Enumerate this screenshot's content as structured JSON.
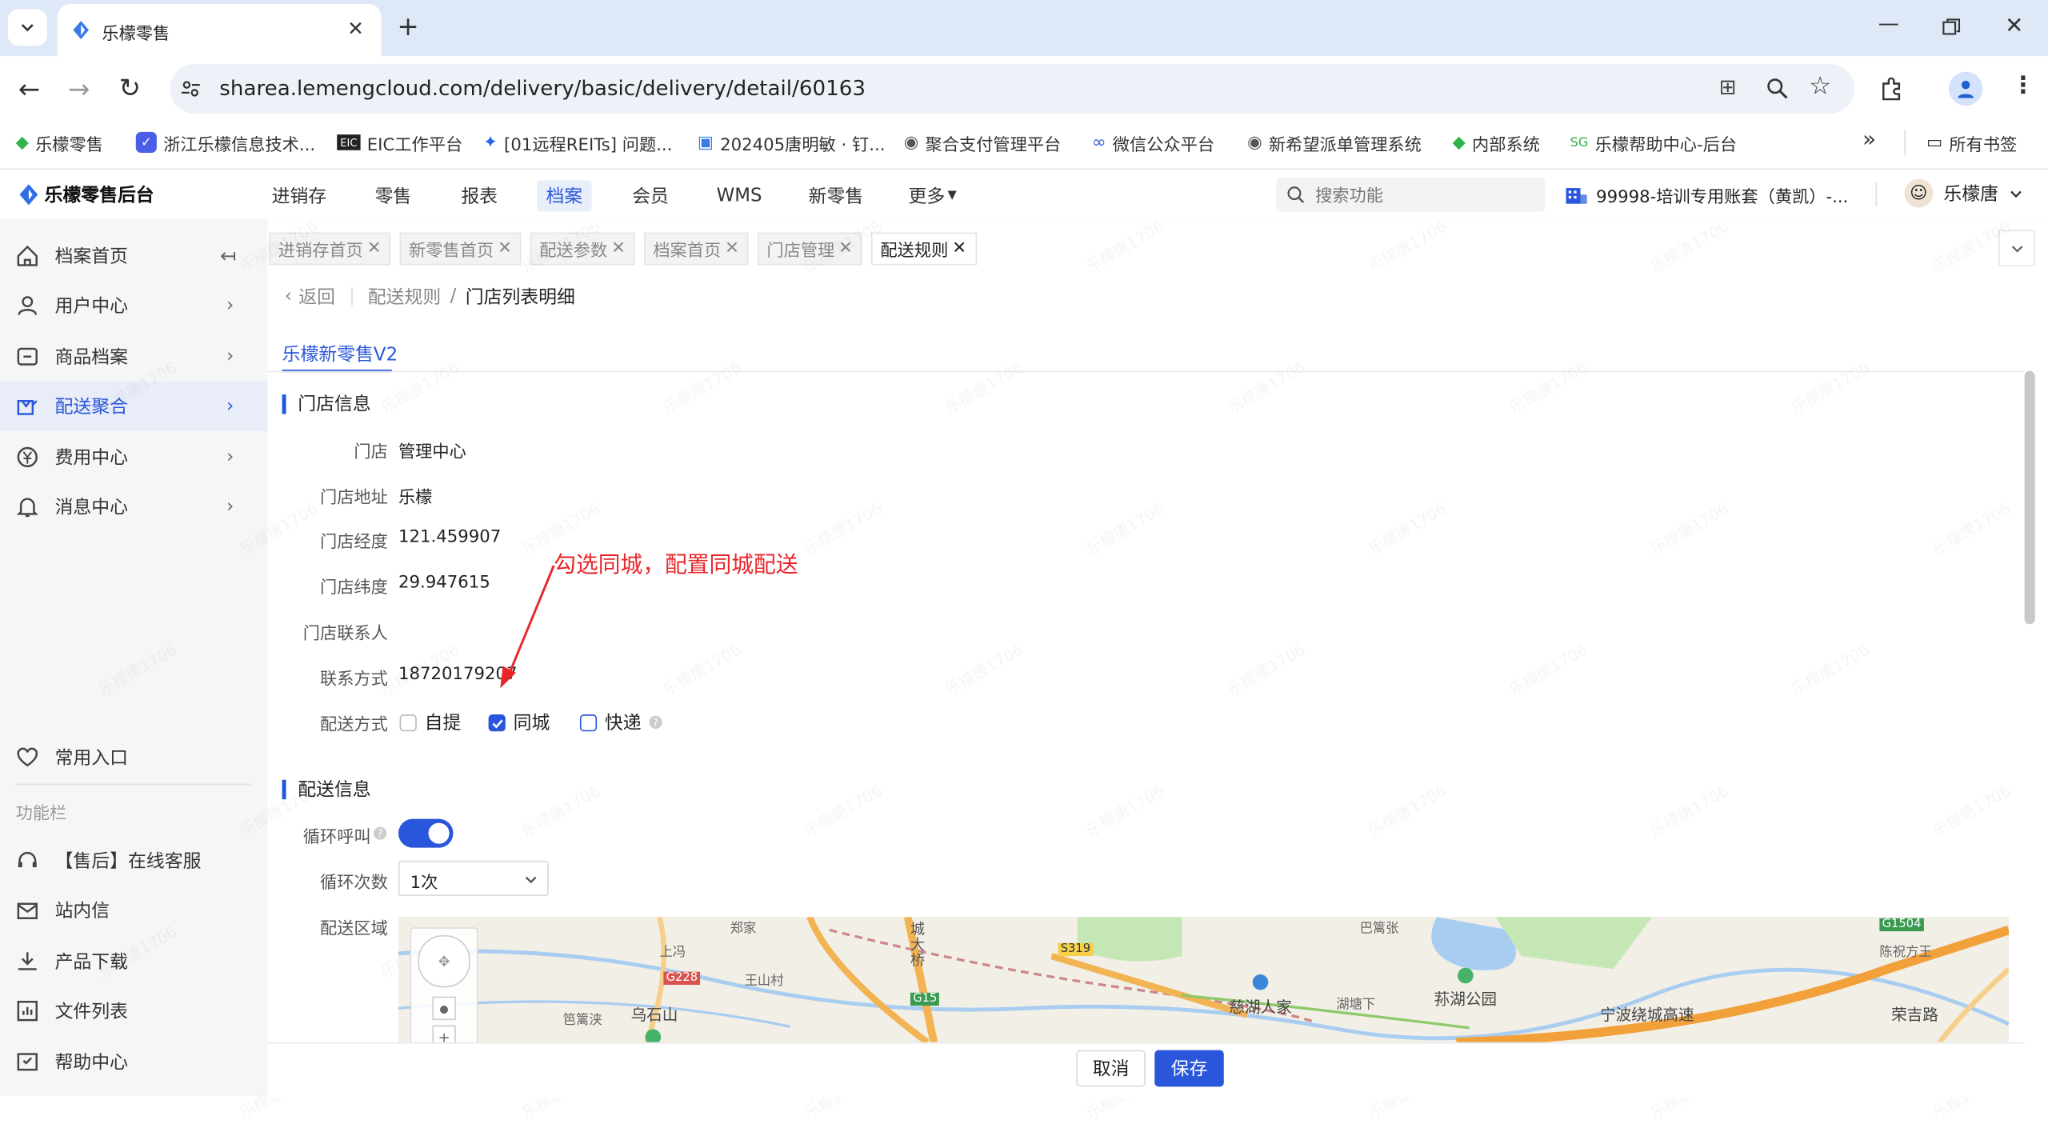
{
  "browser": {
    "tab_title": "乐檬零售",
    "url": "sharea.lemengcloud.com/delivery/basic/delivery/detail/60163",
    "bookmarks": [
      "乐檬零售",
      "浙江乐檬信息技术...",
      "EIC工作平台",
      "[01远程REITs] 问题...",
      "202405唐明敏 · 钉...",
      "聚合支付管理平台",
      "微信公众平台",
      "新希望派单管理系统",
      "内部系统",
      "乐檬帮助中心-后台"
    ],
    "all_bookmarks": "所有书签",
    "more_bookmarks": "»"
  },
  "app": {
    "logo_text": "乐檬零售后台",
    "nav": [
      "进销存",
      "零售",
      "报表",
      "档案",
      "会员",
      "WMS",
      "新零售",
      "更多"
    ],
    "active_nav": "档案",
    "search_placeholder": "搜索功能",
    "account": "99998-培训专用账套（黄凯）-...",
    "user": "乐檬唐"
  },
  "sidebar": {
    "items": [
      {
        "label": "档案首页",
        "icon": "home-icon"
      },
      {
        "label": "用户中心",
        "icon": "user-icon"
      },
      {
        "label": "商品档案",
        "icon": "box-icon"
      },
      {
        "label": "配送聚合",
        "icon": "delivery-icon"
      },
      {
        "label": "费用中心",
        "icon": "yuan-icon"
      },
      {
        "label": "消息中心",
        "icon": "bell-icon"
      }
    ],
    "favorites": "常用入口",
    "function_bar": "功能栏",
    "tools": [
      "【售后】在线客服",
      "站内信",
      "产品下载",
      "文件列表",
      "帮助中心"
    ]
  },
  "tabs": [
    "进销存首页",
    "新零售首页",
    "配送参数",
    "档案首页",
    "门店管理",
    "配送规则"
  ],
  "breadcrumb": {
    "back": "返回",
    "parent": "配送规则",
    "separator": "/",
    "current": "门店列表明细"
  },
  "subtab": "乐檬新零售V2",
  "store_info": {
    "title": "门店信息",
    "fields": [
      {
        "label": "门店",
        "value": "管理中心"
      },
      {
        "label": "门店地址",
        "value": "乐檬"
      },
      {
        "label": "门店经度",
        "value": "121.459907"
      },
      {
        "label": "门店纬度",
        "value": "29.947615"
      },
      {
        "label": "门店联系人",
        "value": ""
      },
      {
        "label": "联系方式",
        "value": "18720179207"
      }
    ],
    "delivery_label": "配送方式",
    "delivery_options": [
      {
        "label": "自提",
        "checked": false
      },
      {
        "label": "同城",
        "checked": true
      },
      {
        "label": "快递",
        "checked": false
      }
    ]
  },
  "annotation": "勾选同城，配置同城配送",
  "delivery_info": {
    "title": "配送信息",
    "loop_call_label": "循环呼叫",
    "loop_call_on": true,
    "loop_count_label": "循环次数",
    "loop_count_value": "1次",
    "area_label": "配送区域"
  },
  "map": {
    "labels": [
      "上冯",
      "郑家",
      "王山村",
      "乌石山",
      "笆篱浃",
      "城大桥",
      "慈湖人家",
      "湖塘下",
      "荪湖公园",
      "宁波绕城高速",
      "荣吉路",
      "陈祝方王",
      "巴篱张"
    ],
    "road_tags": [
      "G228",
      "G15",
      "S319",
      "G1504"
    ]
  },
  "footer": {
    "cancel": "取消",
    "save": "保存"
  },
  "watermark": "乐檬唐1706",
  "colors": {
    "accent": "#2a56dc",
    "annotation": "#e8262a"
  }
}
